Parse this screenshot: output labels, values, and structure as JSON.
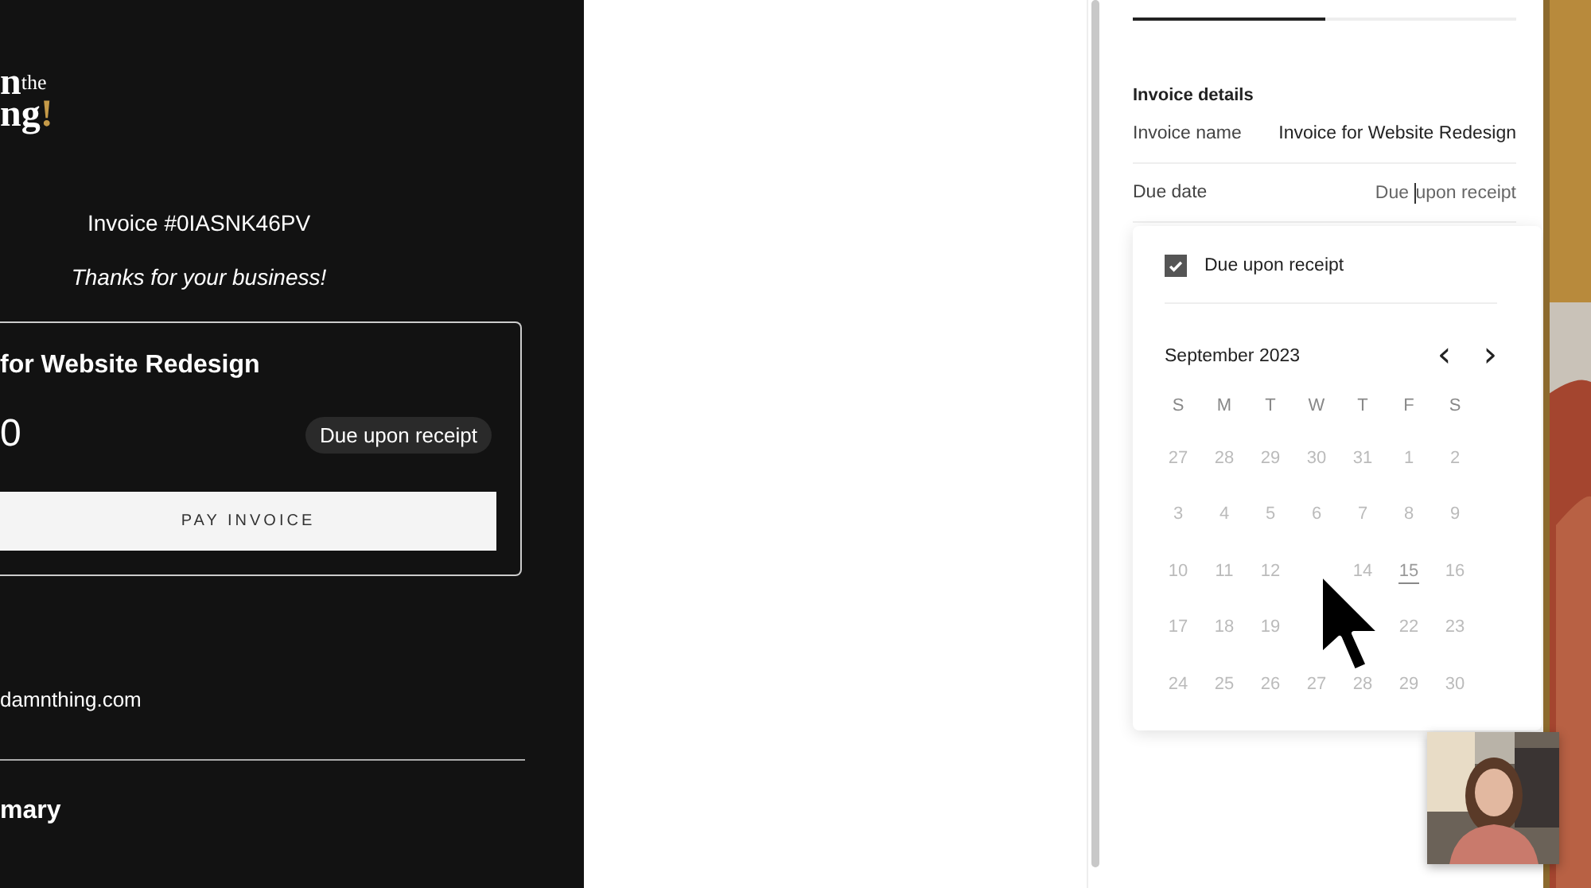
{
  "invoice_preview": {
    "logo": {
      "line_1": "n",
      "line_1_small": "the",
      "line_2": "ng",
      "mark": "!"
    },
    "invoice_number": "Invoice #0IASNK46PV",
    "thanks": "Thanks for your business!",
    "card": {
      "title": "for Website Redesign",
      "amount": "0",
      "due_badge": "Due upon receipt",
      "pay_button": "PAY INVOICE"
    },
    "contact_email": "damnthing.com",
    "section_heading": "mary"
  },
  "settings_panel": {
    "tabs": [
      {
        "selected": true
      },
      {
        "selected": false
      }
    ],
    "section_title": "Invoice details",
    "fields": [
      {
        "label": "Invoice name",
        "value": "Invoice for Website Redesign",
        "caret": false
      },
      {
        "label": "Due date",
        "value_before_caret": "Due ",
        "value": "upon receipt",
        "caret": true
      }
    ],
    "due_popup": {
      "checkbox": {
        "label": "Due upon receipt",
        "checked": true
      },
      "calendar": {
        "month": "September 2023",
        "prev": "‹",
        "next": "›",
        "disabled": true,
        "weekdays": [
          "S",
          "M",
          "T",
          "W",
          "T",
          "F",
          "S"
        ],
        "weeks": [
          {
            "days": [
              {
                "day": "27",
                "today": false
              },
              {
                "day": "28",
                "today": false
              },
              {
                "day": "29",
                "today": false
              },
              {
                "day": "30",
                "today": false
              },
              {
                "day": "31",
                "today": false
              },
              {
                "day": "1",
                "today": false
              },
              {
                "day": "2",
                "today": false
              }
            ]
          },
          {
            "days": [
              {
                "day": "3",
                "today": false
              },
              {
                "day": "4",
                "today": false
              },
              {
                "day": "5",
                "today": false
              },
              {
                "day": "6",
                "today": false
              },
              {
                "day": "7",
                "today": false
              },
              {
                "day": "8",
                "today": false
              },
              {
                "day": "9",
                "today": false
              }
            ]
          },
          {
            "days": [
              {
                "day": "10",
                "today": false
              },
              {
                "day": "11",
                "today": false
              },
              {
                "day": "12",
                "today": false
              }
            ],
            "days_after_cursor": [
              {
                "day": "14",
                "today": false
              },
              {
                "day": "15",
                "today": true
              },
              {
                "day": "16",
                "today": false
              }
            ]
          },
          {
            "days": [
              {
                "day": "17",
                "today": false
              },
              {
                "day": "18",
                "today": false
              },
              {
                "day": "19",
                "today": false
              }
            ],
            "days_after_cursor": [
              {
                "day": "22",
                "today": false
              },
              {
                "day": "23",
                "today": false
              }
            ]
          },
          {
            "days": [
              {
                "day": "24",
                "today": false
              },
              {
                "day": "25",
                "today": false
              },
              {
                "day": "26",
                "today": false
              },
              {
                "day": "27",
                "today": false
              },
              {
                "day": "28",
                "today": false
              },
              {
                "day": "29",
                "today": false
              },
              {
                "day": "30",
                "today": false
              }
            ]
          }
        ]
      }
    }
  }
}
